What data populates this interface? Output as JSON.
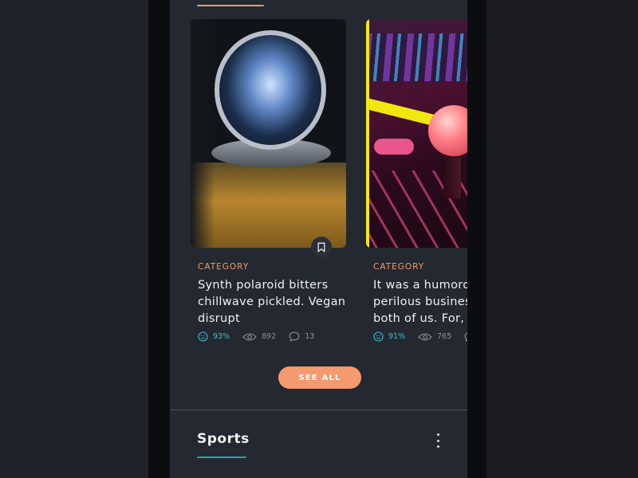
{
  "articles": [
    {
      "image": "astronaut-helmet-photo",
      "category": "CATEGORY",
      "title": "Synth polaroid bitters chillwave pickled. Vegan disrupt",
      "rating": "93%",
      "views": "892",
      "comments": "13"
    },
    {
      "image": "arcade-joystick-neon-photo",
      "category": "CATEGORY",
      "title": "It was a humorous perilous business for both of us. For,",
      "rating": "91%",
      "views": "765",
      "comments": ""
    }
  ],
  "see_all_label": "SEE ALL",
  "section": {
    "title": "Sports"
  },
  "icons": {
    "bookmark": "bookmark-icon",
    "rating": "smiley-icon",
    "views": "eye-icon",
    "comments": "comment-icon",
    "more": "more-vertical-icon"
  },
  "colors": {
    "accent": "#f59a6f",
    "rating": "#34c2c5",
    "background": "#242830",
    "section_underline": "#2e9fb1"
  }
}
